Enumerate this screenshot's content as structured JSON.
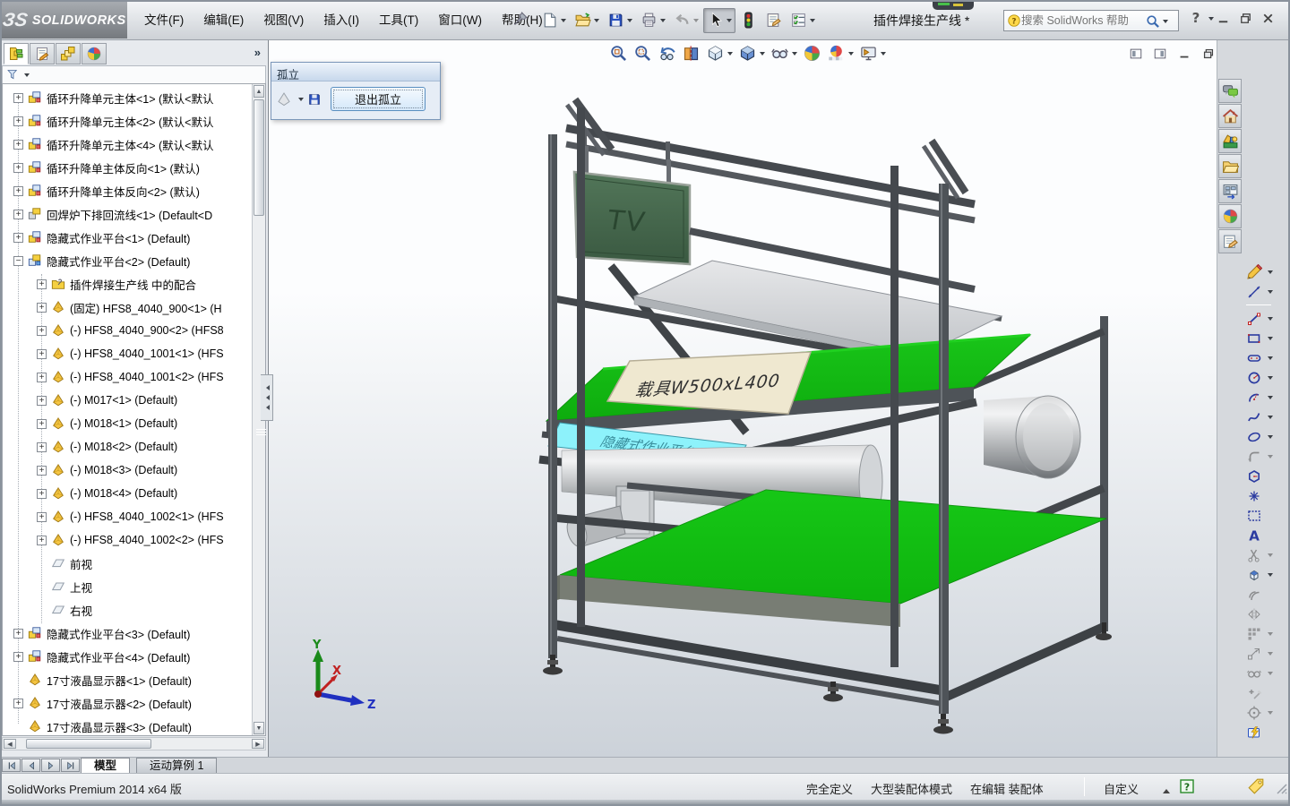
{
  "colors": {
    "viewport-top": "#fcfdfe",
    "viewport-bottom": "#ccd2d9",
    "table-green": "#12bd12",
    "shelf-green": "#10c410",
    "tv-green": "#47684d",
    "panel-cyan": "#8df2fb",
    "plate-cream": "#efe8d0",
    "frame-dark": "#45494e",
    "accent-blue": "#2a52c0"
  },
  "window": {
    "logo_mark": "ЗS",
    "logo_name": "SOLIDWORKS",
    "title": "插件焊接生产线 *"
  },
  "menu_bar": {
    "items": [
      {
        "id": "file",
        "label": "文件(F)"
      },
      {
        "id": "edit",
        "label": "编辑(E)"
      },
      {
        "id": "view",
        "label": "视图(V)"
      },
      {
        "id": "insert",
        "label": "插入(I)"
      },
      {
        "id": "tools",
        "label": "工具(T)"
      },
      {
        "id": "window",
        "label": "窗口(W)"
      },
      {
        "id": "help",
        "label": "帮助(H)"
      }
    ]
  },
  "standard_toolbar": {
    "buttons": [
      {
        "name": "new-button",
        "icon": "new-document-icon",
        "dropdown": true
      },
      {
        "name": "open-button",
        "icon": "open-folder-icon",
        "dropdown": true
      },
      {
        "name": "save-button",
        "icon": "save-icon",
        "dropdown": true
      },
      {
        "name": "print-button",
        "icon": "print-icon",
        "dropdown": true
      },
      {
        "name": "undo-button",
        "icon": "undo-icon",
        "dropdown": true,
        "disabled": true
      },
      {
        "name": "select-button",
        "icon": "select-cursor-icon",
        "dropdown": true,
        "pressed": true
      },
      {
        "name": "rebuild-button",
        "icon": "traffic-light-icon"
      },
      {
        "name": "file-properties-button",
        "icon": "file-properties-icon"
      },
      {
        "name": "options-button",
        "icon": "options-icon",
        "dropdown": true
      }
    ]
  },
  "search_box": {
    "placeholder": "搜索 SolidWorks 帮助"
  },
  "feature_manager": {
    "tabs": [
      {
        "name": "tab-featuremanager",
        "icon": "fm-tree-icon",
        "active": true
      },
      {
        "name": "tab-propertymanager",
        "icon": "fm-properties-icon"
      },
      {
        "name": "tab-configurationmanager",
        "icon": "fm-configurations-icon"
      },
      {
        "name": "tab-displaymanager",
        "icon": "fm-display-icon"
      }
    ],
    "overflow_chevron": "»"
  },
  "feature_tree": {
    "rows": [
      {
        "depth": 0,
        "expander": "plus",
        "icon": "assembly-icon",
        "label": "循环升降单元主体<1> (默认<默认"
      },
      {
        "depth": 0,
        "expander": "plus",
        "icon": "assembly-icon",
        "label": "循环升降单元主体<2> (默认<默认"
      },
      {
        "depth": 0,
        "expander": "plus",
        "icon": "assembly-icon",
        "label": "循环升降单元主体<4> (默认<默认"
      },
      {
        "depth": 0,
        "expander": "plus",
        "icon": "assembly-icon",
        "label": "循环升降单主体反向<1> (默认)"
      },
      {
        "depth": 0,
        "expander": "plus",
        "icon": "assembly-icon",
        "label": "循环升降单主体反向<2> (默认)"
      },
      {
        "depth": 0,
        "expander": "plus",
        "icon": "assembly-alt-icon",
        "label": "回焊炉下排回流线<1> (Default<D"
      },
      {
        "depth": 0,
        "expander": "plus",
        "icon": "assembly-icon",
        "label": "隐藏式作业平台<1> (Default)"
      },
      {
        "depth": 0,
        "expander": "minus",
        "icon": "assembly-open-icon",
        "label": "隐藏式作业平台<2> (Default)"
      },
      {
        "depth": 1,
        "expander": "plus",
        "icon": "mates-icon",
        "label": "插件焊接生产线 中的配合"
      },
      {
        "depth": 1,
        "expander": "plus",
        "icon": "part-icon",
        "label": "(固定) HFS8_4040_900<1> (H"
      },
      {
        "depth": 1,
        "expander": "plus",
        "icon": "part-icon",
        "label": "(-) HFS8_4040_900<2> (HFS8"
      },
      {
        "depth": 1,
        "expander": "plus",
        "icon": "part-icon",
        "label": "(-) HFS8_4040_1001<1> (HFS"
      },
      {
        "depth": 1,
        "expander": "plus",
        "icon": "part-icon",
        "label": "(-) HFS8_4040_1001<2> (HFS"
      },
      {
        "depth": 1,
        "expander": "plus",
        "icon": "part-icon",
        "label": "(-) M017<1> (Default)"
      },
      {
        "depth": 1,
        "expander": "plus",
        "icon": "part-icon",
        "label": "(-) M018<1> (Default)"
      },
      {
        "depth": 1,
        "expander": "plus",
        "icon": "part-icon",
        "label": "(-) M018<2> (Default)"
      },
      {
        "depth": 1,
        "expander": "plus",
        "icon": "part-icon",
        "label": "(-) M018<3> (Default)"
      },
      {
        "depth": 1,
        "expander": "plus",
        "icon": "part-icon",
        "label": "(-) M018<4> (Default)"
      },
      {
        "depth": 1,
        "expander": "plus",
        "icon": "part-icon",
        "label": "(-) HFS8_4040_1002<1> (HFS"
      },
      {
        "depth": 1,
        "expander": "plus",
        "icon": "part-icon",
        "label": "(-) HFS8_4040_1002<2> (HFS"
      },
      {
        "depth": 1,
        "expander": "none",
        "icon": "plane-icon",
        "label": "前视"
      },
      {
        "depth": 1,
        "expander": "none",
        "icon": "plane-icon",
        "label": "上视"
      },
      {
        "depth": 1,
        "expander": "none",
        "icon": "plane-icon",
        "label": "右视"
      },
      {
        "depth": 0,
        "expander": "plus",
        "icon": "assembly-icon",
        "label": "隐藏式作业平台<3> (Default)"
      },
      {
        "depth": 0,
        "expander": "plus",
        "icon": "assembly-icon",
        "label": "隐藏式作业平台<4> (Default)"
      },
      {
        "depth": 0,
        "expander": "none",
        "icon": "part-icon",
        "label": "17寸液晶显示器<1> (Default)"
      },
      {
        "depth": 0,
        "expander": "plus",
        "icon": "part-icon",
        "label": "17寸液晶显示器<2> (Default)"
      },
      {
        "depth": 0,
        "expander": "none",
        "icon": "part-icon",
        "label": "17寸液晶显示器<3> (Default)"
      }
    ]
  },
  "isolate_popup": {
    "title": "孤立",
    "exit_button": "退出孤立"
  },
  "headsup_toolbar": {
    "buttons": [
      {
        "name": "zoom-fit-button",
        "icon": "zoom-fit-icon"
      },
      {
        "name": "zoom-to-area-button",
        "icon": "zoom-area-icon"
      },
      {
        "name": "previous-view-button",
        "icon": "previous-view-icon"
      },
      {
        "name": "section-view-button",
        "icon": "section-view-icon"
      },
      {
        "name": "view-orientation-button",
        "icon": "view-orientation-icon",
        "dropdown": true
      },
      {
        "name": "display-style-button",
        "icon": "display-style-icon",
        "dropdown": true
      },
      {
        "name": "hide-show-items-button",
        "icon": "hide-show-icon",
        "dropdown": true
      },
      {
        "name": "edit-appearance-button",
        "icon": "appearance-ball-icon"
      },
      {
        "name": "apply-scene-button",
        "icon": "apply-scene-icon",
        "dropdown": true
      },
      {
        "name": "view-settings-button",
        "icon": "view-settings-icon",
        "dropdown": true
      }
    ]
  },
  "document_controls": {
    "buttons": [
      {
        "name": "pane-left-button",
        "icon": "pane-left-icon"
      },
      {
        "name": "pane-right-button",
        "icon": "pane-right-icon"
      },
      {
        "name": "minimize-doc-button",
        "icon": "minimize-icon"
      },
      {
        "name": "restore-doc-button",
        "icon": "restore-icon"
      },
      {
        "name": "close-doc-button",
        "icon": "close-icon"
      }
    ]
  },
  "task_pane": {
    "buttons": [
      {
        "name": "solidworks-forum-button",
        "icon": "forum-icon"
      },
      {
        "name": "solidworks-resources-button",
        "icon": "home-icon"
      },
      {
        "name": "design-library-button",
        "icon": "design-library-icon"
      },
      {
        "name": "file-explorer-button",
        "icon": "file-explorer-icon"
      },
      {
        "name": "view-palette-button",
        "icon": "view-palette-icon"
      },
      {
        "name": "appearances-scenes-button",
        "icon": "appearances-ball-icon"
      },
      {
        "name": "custom-properties-button",
        "icon": "custom-properties-icon"
      }
    ]
  },
  "sketch_toolbar": {
    "buttons": [
      {
        "name": "sketch-button",
        "icon": "sketch-pencil-icon",
        "dropdown": true
      },
      {
        "name": "smart-dimension-button",
        "icon": "smart-dimension-icon",
        "dropdown": true
      },
      {
        "divider": true
      },
      {
        "name": "line-button",
        "icon": "line-icon",
        "dropdown": true
      },
      {
        "name": "corner-rectangle-button",
        "icon": "rectangle-icon",
        "dropdown": true
      },
      {
        "name": "straight-slot-button",
        "icon": "slot-icon",
        "dropdown": true
      },
      {
        "name": "circle-button",
        "icon": "circle-icon",
        "dropdown": true
      },
      {
        "name": "centerpoint-arc-button",
        "icon": "arc-icon",
        "dropdown": true
      },
      {
        "name": "spline-button",
        "icon": "spline-icon",
        "dropdown": true
      },
      {
        "name": "ellipse-button",
        "icon": "ellipse-icon",
        "dropdown": true
      },
      {
        "name": "sketch-fillet-button",
        "icon": "fillet-icon",
        "dropdown": true,
        "disabled": true
      },
      {
        "name": "polygon-button",
        "icon": "polygon-icon"
      },
      {
        "name": "point-button",
        "icon": "point-icon"
      },
      {
        "name": "sketch-picture-button",
        "icon": "sketch-picture-icon"
      },
      {
        "name": "text-button",
        "icon": "text-icon"
      },
      {
        "name": "trim-entities-button",
        "icon": "trim-icon",
        "dropdown": true,
        "disabled": true
      },
      {
        "name": "convert-entities-button",
        "icon": "convert-entities-icon",
        "dropdown": true
      },
      {
        "name": "offset-entities-button",
        "icon": "offset-icon",
        "disabled": true
      },
      {
        "name": "mirror-entities-button",
        "icon": "mirror-icon",
        "disabled": true
      },
      {
        "name": "linear-pattern-button",
        "icon": "linear-pattern-icon",
        "dropdown": true,
        "disabled": true
      },
      {
        "name": "move-entities-button",
        "icon": "move-entities-icon",
        "dropdown": true,
        "disabled": true
      },
      {
        "name": "display-relations-button",
        "icon": "display-relations-icon",
        "dropdown": true,
        "disabled": true
      },
      {
        "name": "repair-sketch-button",
        "icon": "repair-sketch-icon",
        "disabled": true
      },
      {
        "name": "quick-snaps-button",
        "icon": "quick-snaps-icon",
        "dropdown": true,
        "disabled": true
      },
      {
        "name": "rapid-sketch-button",
        "icon": "rapid-sketch-icon"
      }
    ]
  },
  "model": {
    "tv_label": "TV",
    "carrier_label": "载具W500xL400",
    "panel_label": "隐藏式作业平台",
    "triad": {
      "x": "X",
      "y": "Y",
      "z": "Z"
    }
  },
  "bottom_tabs": {
    "nav_buttons": [
      {
        "name": "nav-first-button",
        "icon": "nav-first-icon"
      },
      {
        "name": "nav-prev-button",
        "icon": "nav-prev-icon"
      },
      {
        "name": "nav-next-button",
        "icon": "nav-next-icon"
      },
      {
        "name": "nav-last-button",
        "icon": "nav-last-icon"
      }
    ],
    "model": "模型",
    "motion_study": "运动算例 1"
  },
  "status_bar": {
    "left": "SolidWorks Premium 2014 x64 版",
    "define_state": "完全定义",
    "assembly_mode": "大型装配体模式",
    "editing": "在编辑 装配体",
    "custom": "自定义"
  }
}
